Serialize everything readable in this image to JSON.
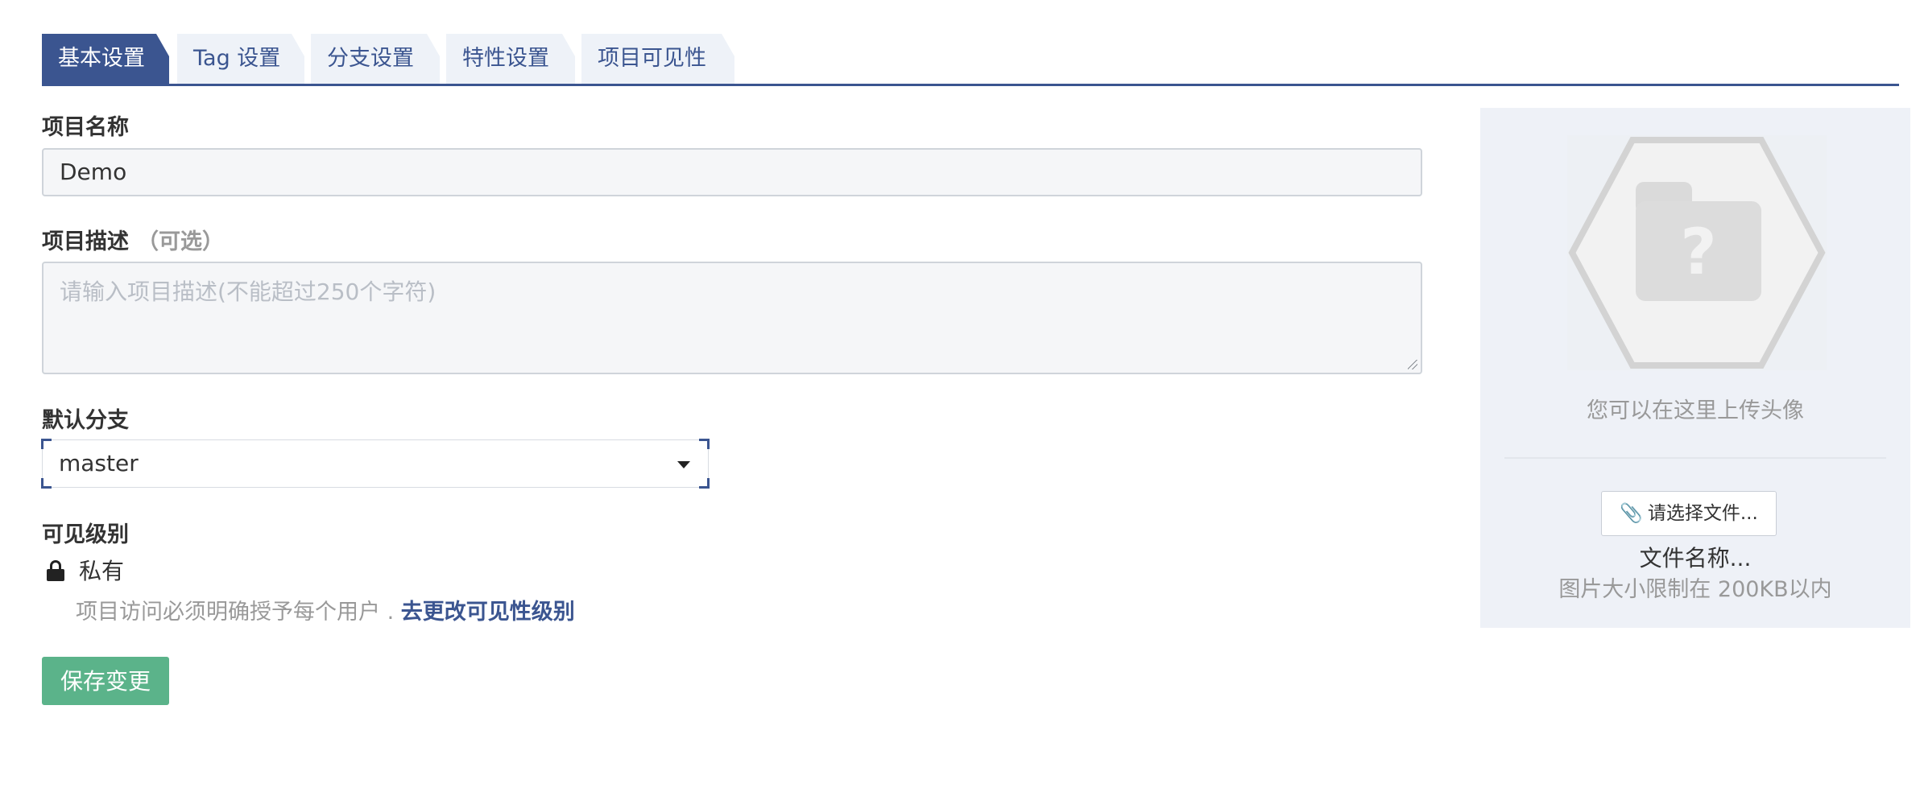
{
  "tabs": [
    {
      "label": "基本设置",
      "active": true
    },
    {
      "label": "Tag 设置",
      "active": false
    },
    {
      "label": "分支设置",
      "active": false
    },
    {
      "label": "特性设置",
      "active": false
    },
    {
      "label": "项目可见性",
      "active": false
    }
  ],
  "form": {
    "name_label": "项目名称",
    "name_value": "Demo",
    "desc_label": "项目描述",
    "desc_optional": "（可选）",
    "desc_placeholder": "请输入项目描述(不能超过250个字符)",
    "branch_label": "默认分支",
    "branch_value": "master",
    "visibility_label": "可见级别",
    "visibility_value": "私有",
    "visibility_desc": "项目访问必须明确授予每个用户 . ",
    "visibility_link": "去更改可见性级别",
    "save_label": "保存变更"
  },
  "avatar": {
    "upload_hint": "您可以在这里上传头像",
    "choose_file_label": "请选择文件...",
    "file_name": "文件名称...",
    "size_limit": "图片大小限制在 200KB以内"
  },
  "colors": {
    "accent": "#3b5590",
    "save_button": "#5bb38a",
    "side_panel_bg": "#eef1f7"
  },
  "icons": {
    "lock": "lock-icon",
    "paperclip": "paperclip-icon",
    "caret": "caret-down-icon",
    "avatar": "folder-question-icon"
  }
}
